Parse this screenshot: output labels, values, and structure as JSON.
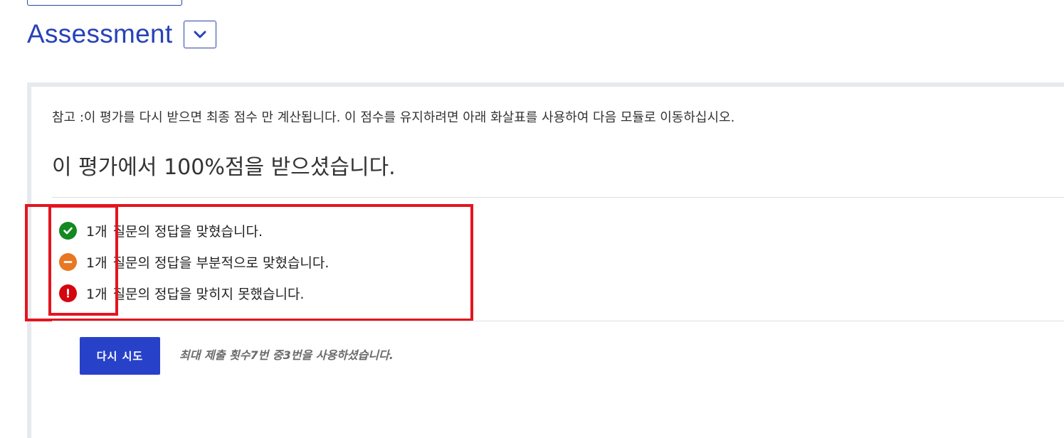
{
  "header": {
    "title": "Assessment",
    "toggle_icon": "chevron-down-icon"
  },
  "assessment": {
    "note": "참고 :이 평가를 다시 받으면 최종 점수 만 계산됩니다. 이 점수를 유지하려면 아래 화살표를 사용하여 다음 모듈로 이동하십시오.",
    "score_message": "이 평가에서 100%점을 받으셨습니다.",
    "results": [
      {
        "icon": "check-circle-icon",
        "color": "#138a1f",
        "count": "1개",
        "text": "질문의 정답을 맞혔습니다."
      },
      {
        "icon": "minus-circle-icon",
        "color": "#e87722",
        "count": "1개",
        "text": "질문의 정답을 부분적으로 맞혔습니다."
      },
      {
        "icon": "exclamation-circle-icon",
        "color": "#d4060e",
        "count": "1개",
        "text": "질문의 정답을 맞히지 못했습니다."
      }
    ],
    "retry_label": "다시 시도",
    "attempts_text": "최대 제출 횟수7번 중3번을 사용하셨습니다."
  },
  "annotation": {
    "highlight_color": "#e3151f"
  }
}
